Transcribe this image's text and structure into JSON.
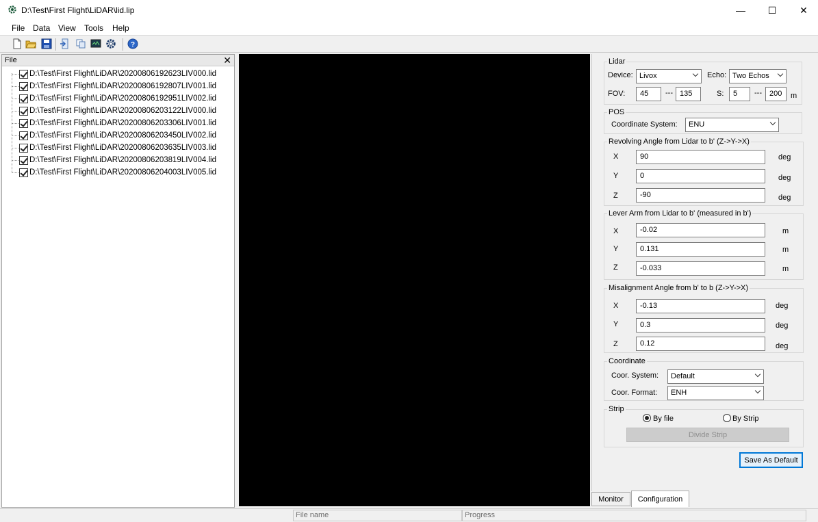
{
  "window": {
    "title": "D:\\Test\\First Flight\\LiDAR\\lid.lip",
    "minimize": "—",
    "maximize": "☐",
    "close": "✕"
  },
  "menu": [
    "File",
    "Data",
    "View",
    "Tools",
    "Help"
  ],
  "toolbar": {
    "icons": [
      "new-file-icon",
      "open-folder-icon",
      "save-icon",
      "import-icon",
      "copy-icon",
      "monitor-icon",
      "settings-gear-icon",
      "help-icon"
    ]
  },
  "file_panel": {
    "header": "File",
    "close": "✕",
    "files": [
      "D:\\Test\\First Flight\\LiDAR\\20200806192623LIV000.lid",
      "D:\\Test\\First Flight\\LiDAR\\20200806192807LIV001.lid",
      "D:\\Test\\First Flight\\LiDAR\\20200806192951LIV002.lid",
      "D:\\Test\\First Flight\\LiDAR\\20200806203122LIV000.lid",
      "D:\\Test\\First Flight\\LiDAR\\20200806203306LIV001.lid",
      "D:\\Test\\First Flight\\LiDAR\\20200806203450LIV002.lid",
      "D:\\Test\\First Flight\\LiDAR\\20200806203635LIV003.lid",
      "D:\\Test\\First Flight\\LiDAR\\20200806203819LIV004.lid",
      "D:\\Test\\First Flight\\LiDAR\\20200806204003LIV005.lid"
    ]
  },
  "config": {
    "lidar": {
      "title": "Lidar",
      "device_label": "Device:",
      "device": "Livox",
      "echo_label": "Echo:",
      "echo": "Two Echos",
      "fov_label": "FOV:",
      "fov_min": "45",
      "fov_sep": "---",
      "fov_max": "135",
      "s_label": "S:",
      "s_min": "5",
      "s_sep": "---",
      "s_max": "200",
      "s_unit": "m"
    },
    "pos": {
      "title": "POS",
      "coord_label": "Coordinate System:",
      "coord": "ENU"
    },
    "revolving": {
      "title": "Revolving Angle from Lidar to b' (Z->Y->X)",
      "x_label": "X",
      "x": "90",
      "x_unit": "deg",
      "y_label": "Y",
      "y": "0",
      "y_unit": "deg",
      "z_label": "Z",
      "z": "-90",
      "z_unit": "deg"
    },
    "lever": {
      "title": "Lever Arm from Lidar to b' (measured in b')",
      "x_label": "X",
      "x": "-0.02",
      "x_unit": "m",
      "y_label": "Y",
      "y": "0.131",
      "y_unit": "m",
      "z_label": "Z",
      "z": "-0.033",
      "z_unit": "m"
    },
    "misalignment": {
      "title": "Misalignment Angle from b' to b (Z->Y->X)",
      "x_label": "X",
      "x": "-0.13",
      "x_unit": "deg",
      "y_label": "Y",
      "y": "0.3",
      "y_unit": "deg",
      "z_label": "Z",
      "z": "0.12",
      "z_unit": "deg"
    },
    "coordinate": {
      "title": "Coordinate",
      "system_label": "Coor. System:",
      "system": "Default",
      "format_label": "Coor. Format:",
      "format": "ENH"
    },
    "strip": {
      "title": "Strip",
      "by_file": "By file",
      "by_strip": "By Strip",
      "selected": "By file",
      "divide": "Divide Strip"
    },
    "save_default": "Save As Default"
  },
  "tabs": [
    "Monitor",
    "Configuration"
  ],
  "active_tab": "Configuration",
  "status": {
    "file_name": "File name",
    "progress": "Progress"
  }
}
